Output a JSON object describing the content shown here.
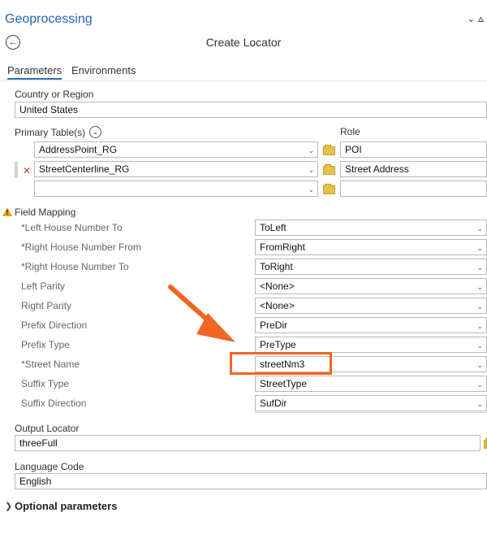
{
  "header": {
    "panel_title": "Geoprocessing",
    "pin_glyphs": "⌄  ⩟",
    "tool_title": "Create Locator"
  },
  "tabs": [
    {
      "label": "Parameters",
      "active": true
    },
    {
      "label": "Environments",
      "active": false
    }
  ],
  "country": {
    "label": "Country or Region",
    "value": "United States"
  },
  "primary": {
    "label": "Primary Table(s)",
    "role_label": "Role",
    "rows": [
      {
        "table": "AddressPoint_RG",
        "role": "POI"
      },
      {
        "table": "StreetCenterline_RG",
        "role": "Street Address"
      },
      {
        "table": "",
        "role": ""
      }
    ]
  },
  "field_mapping": {
    "label": "Field Mapping",
    "rows": [
      {
        "label": "*Left House Number To",
        "value": "ToLeft"
      },
      {
        "label": "*Right House Number From",
        "value": "FromRight"
      },
      {
        "label": "*Right House Number To",
        "value": "ToRight"
      },
      {
        "label": "Left Parity",
        "value": "<None>"
      },
      {
        "label": "Right Parity",
        "value": "<None>"
      },
      {
        "label": "Prefix Direction",
        "value": "PreDir"
      },
      {
        "label": "Prefix Type",
        "value": "PreType"
      },
      {
        "label": "*Street Name",
        "value": "streetNm3"
      },
      {
        "label": "Suffix Type",
        "value": "StreetType"
      },
      {
        "label": "Suffix Direction",
        "value": "SufDir"
      }
    ]
  },
  "output": {
    "label": "Output Locator",
    "value": "threeFull"
  },
  "language": {
    "label": "Language Code",
    "value": "English"
  },
  "optional": {
    "label": "Optional parameters"
  },
  "colors": {
    "accent": "#2266b3",
    "annotation": "#f26522",
    "warning": "#e8a317"
  }
}
